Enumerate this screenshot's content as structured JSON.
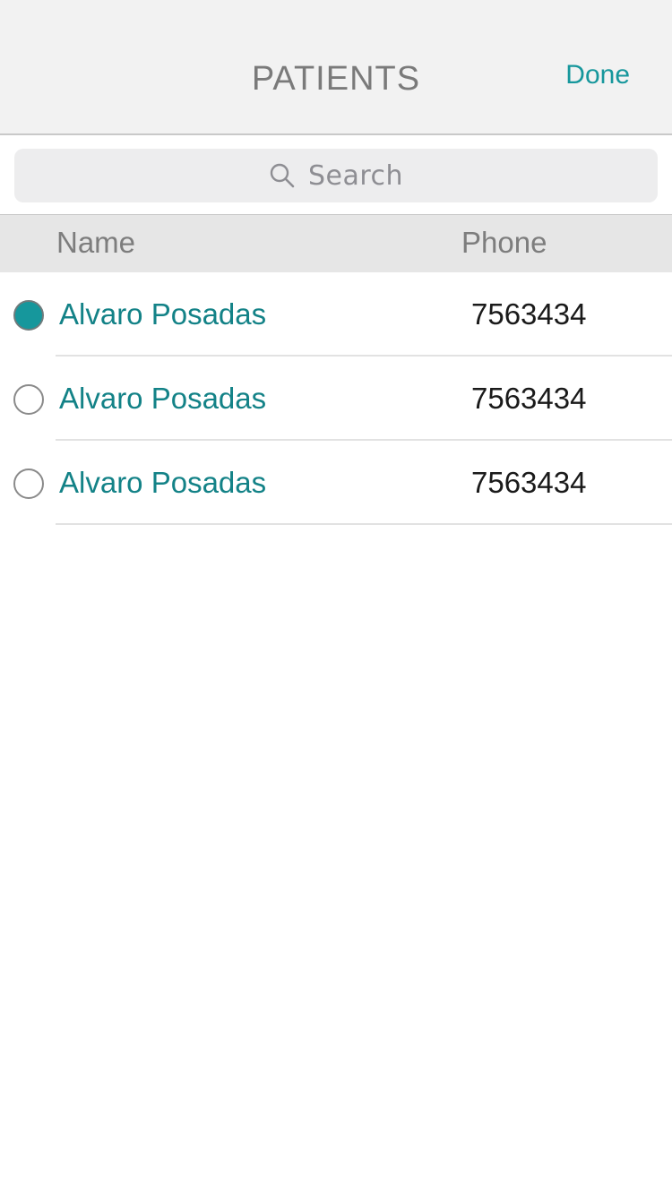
{
  "navbar": {
    "title": "PATIENTS",
    "done_label": "Done"
  },
  "search": {
    "placeholder": "Search",
    "icon": "search-icon"
  },
  "table": {
    "columns": [
      "Name",
      "Phone"
    ],
    "rows": [
      {
        "name": "Alvaro Posadas",
        "phone": "7563434",
        "selected": true
      },
      {
        "name": "Alvaro Posadas",
        "phone": "7563434",
        "selected": false
      },
      {
        "name": "Alvaro Posadas",
        "phone": "7563434",
        "selected": false
      }
    ]
  },
  "colors": {
    "accent": "#16979c",
    "name_text": "#138287",
    "navbar_bg": "#f2f2f2",
    "header_bg": "#e6e6e6"
  }
}
